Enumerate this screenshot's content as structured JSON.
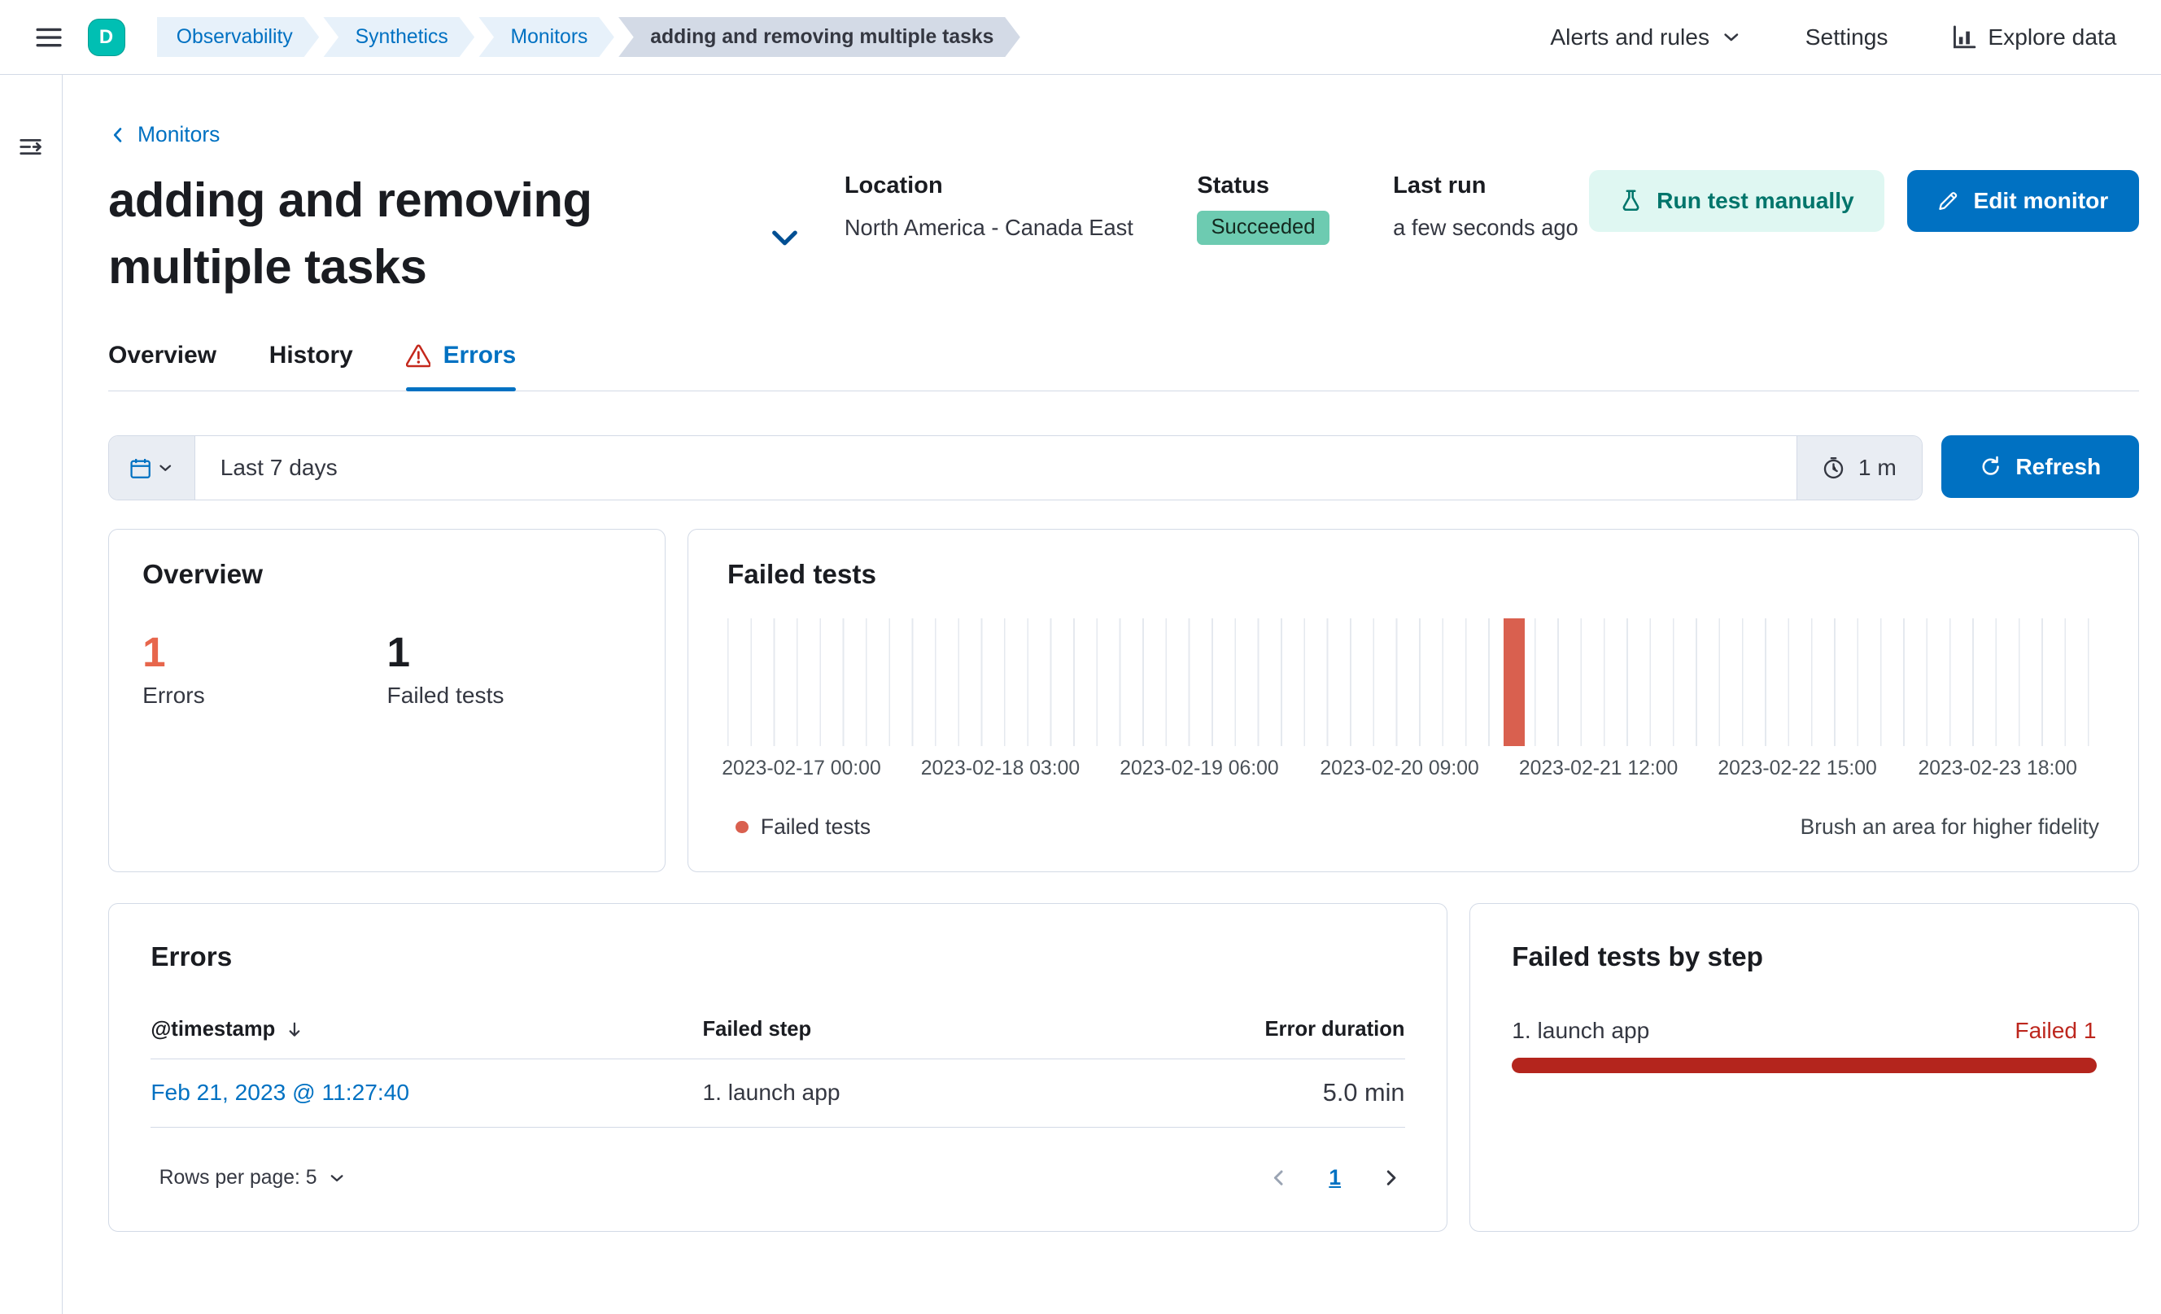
{
  "header": {
    "logo_letter": "D",
    "breadcrumbs": [
      "Observability",
      "Synthetics",
      "Monitors",
      "adding and removing multiple tasks"
    ],
    "alerts_menu": "Alerts and rules",
    "settings": "Settings",
    "explore_data": "Explore data"
  },
  "page": {
    "back_link": "Monitors",
    "title": "adding and removing multiple tasks",
    "location_label": "Location",
    "location_value": "North America - Canada East",
    "status_label": "Status",
    "status_value": "Succeeded",
    "last_run_label": "Last run",
    "last_run_value": "a few seconds ago",
    "run_test_button": "Run test manually",
    "edit_button": "Edit monitor"
  },
  "tabs": {
    "overview": "Overview",
    "history": "History",
    "errors": "Errors"
  },
  "datebar": {
    "range": "Last 7 days",
    "interval": "1 m",
    "refresh": "Refresh"
  },
  "overview_panel": {
    "title": "Overview",
    "stats": [
      {
        "value": "1",
        "label": "Errors",
        "color": "#e7664c"
      },
      {
        "value": "1",
        "label": "Failed tests",
        "color": "#1a1c21"
      }
    ]
  },
  "chart_data": {
    "type": "bar",
    "title": "Failed tests",
    "x_tick_labels": [
      "2023-02-17 00:00",
      "2023-02-18 03:00",
      "2023-02-19 06:00",
      "2023-02-20 09:00",
      "2023-02-21 12:00",
      "2023-02-22 15:00",
      "2023-02-23 18:00"
    ],
    "x_tick_positions_pct": [
      5.4,
      19.9,
      34.4,
      49.0,
      63.5,
      78.0,
      92.6
    ],
    "series": [
      {
        "name": "Failed tests",
        "points": [
          {
            "x": "2023-02-21 11:27",
            "y": 1
          }
        ]
      }
    ],
    "ylim": [
      0,
      1
    ],
    "grid": "vertical",
    "bar_left_pct": 56.6,
    "bar_width_pct": 1.5,
    "bar_color": "#d9604f",
    "legend": [
      "Failed tests"
    ],
    "legend_position": "bottom-left",
    "hint": "Brush an area for higher fidelity"
  },
  "errors_panel": {
    "title": "Errors",
    "columns": [
      "@timestamp",
      "Failed step",
      "Error duration"
    ],
    "rows": [
      {
        "timestamp": "Feb 21, 2023 @ 11:27:40",
        "failed_step": "1. launch app",
        "duration": "5.0 min"
      }
    ],
    "rows_per_page": "Rows per page: 5",
    "page": "1"
  },
  "failed_steps_panel": {
    "title": "Failed tests by step",
    "steps": [
      {
        "name": "1. launch app",
        "result": "Failed 1",
        "width": "100%",
        "color": "#b4251d",
        "result_color": "#bd271e"
      }
    ]
  }
}
